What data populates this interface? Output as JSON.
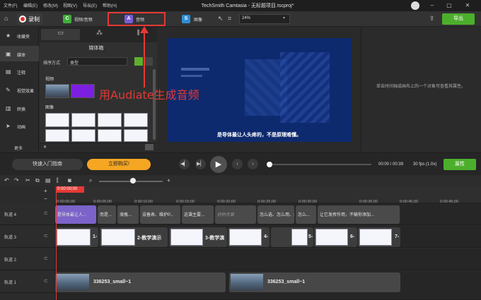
{
  "menu": [
    "文件(F)",
    "编辑(E)",
    "修改(M)",
    "视图(V)",
    "导出(E)",
    "帮助(H)"
  ],
  "window_title": "TechSmith Camtasia - 无标题项目.tscproj*",
  "toolbar": {
    "record_label": "录制",
    "tabs": [
      {
        "label": "视频/音频",
        "icon": "C",
        "color": "#3fae3a"
      },
      {
        "label": "音频",
        "icon": "A",
        "color": "#7a5cd6"
      },
      {
        "label": "图像",
        "icon": "S",
        "color": "#2d8fd8"
      }
    ],
    "zoom": "24%",
    "export_label": "导出"
  },
  "sidebar": {
    "items": [
      {
        "label": "收藏夹",
        "icon": "★"
      },
      {
        "label": "媒体",
        "icon": "▣"
      },
      {
        "label": "注释",
        "icon": "▤"
      },
      {
        "label": "视觉效果",
        "icon": "✎"
      },
      {
        "label": "转换",
        "icon": "▥"
      },
      {
        "label": "动画",
        "icon": "➤"
      }
    ],
    "more": "更多"
  },
  "media_bin": {
    "title": "媒体箱",
    "sort_label": "排序方式",
    "sort_value": "类型",
    "section_video": "视频",
    "section_image": "图像",
    "add": "+"
  },
  "canvas": {
    "subtitle": "是导体最让人头疼的，不是原理难懂。"
  },
  "properties": {
    "hint": "单击时间轴或画布上的一个对象可查看其属性。"
  },
  "annotation": {
    "text": "用Audiate生成音频"
  },
  "controls": {
    "guide_label": "快速入门指南",
    "buy_label": "立即购买!",
    "time": "00:00 / 00:39",
    "fps": "30 fps (1.0x)",
    "props_label": "属性"
  },
  "timeline": {
    "playhead": "0:00:00;00",
    "ticks": [
      "0:00:00;00",
      "0:00:05;00",
      "0:00:10;00",
      "0:00:15;00",
      "0:00:20;00",
      "0:00:25;00",
      "0:00:30;00",
      "0:00:35;00",
      "0:00:40;00",
      "0:00:45;00"
    ],
    "tracks": [
      "轨道 4",
      "轨道 3",
      "轨道 2",
      "轨道 1"
    ],
    "captions": [
      "是导体最让人...",
      "而是...",
      "液瓶...",
      "设备表、维护P...",
      "这课主要...",
      "好的手算",
      "怎么选、怎么用、怎么...",
      "怎么...",
      "让它发挥作用，不输你添加..."
    ],
    "images": [
      "1-",
      "2-教学演示",
      "3-教学演",
      "4-",
      "5-",
      "6-",
      "7-"
    ],
    "videos": [
      "336253_small~1",
      "336253_small~1"
    ]
  }
}
